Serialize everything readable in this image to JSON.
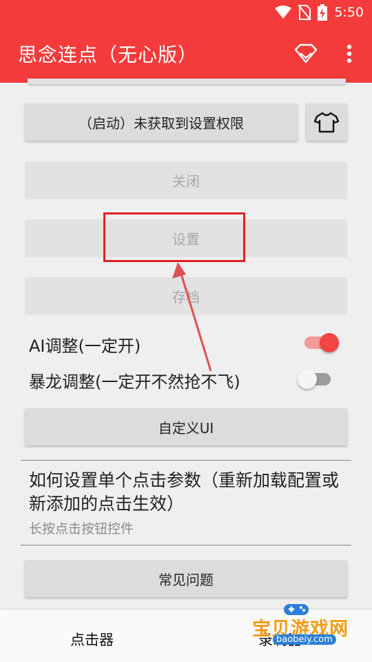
{
  "status_bar": {
    "time": "5:50",
    "icons": [
      "wifi-icon",
      "no-sim-icon",
      "battery-charging-icon"
    ]
  },
  "app_bar": {
    "title": "思念连点（无心版）",
    "actions": [
      "diamond-icon",
      "more-vert-icon"
    ]
  },
  "buttons": {
    "start_label": "（启动）未获取到设置权限",
    "shirt_icon": "tshirt-icon",
    "close_label": "关闭",
    "settings_label": "设置",
    "save_label": "存档",
    "custom_ui_label": "自定义UI",
    "faq_label": "常见问题"
  },
  "toggles": [
    {
      "label": "AI调整(一定开)",
      "on": true
    },
    {
      "label": "暴龙调整(一定开不然抢不飞)",
      "on": false
    }
  ],
  "help_section": {
    "title": "如何设置单个点击参数（重新加载配置或新添加的点击生效）",
    "subtitle": "长按点击按钮控件"
  },
  "bottom_nav": {
    "tabs": [
      "点击器",
      "录制器"
    ]
  },
  "watermark": {
    "title": "宝贝游戏网",
    "url": "baobeiy.com"
  },
  "colors": {
    "primary": "#f43b3b",
    "switch_on": "#f44545",
    "annotation": "#e02020"
  }
}
